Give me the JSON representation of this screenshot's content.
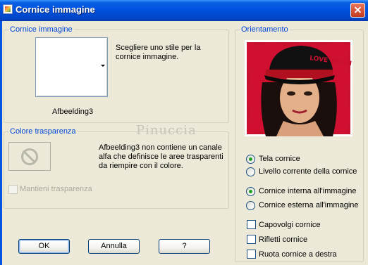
{
  "window": {
    "title": "Cornice immagine"
  },
  "frame_group": {
    "label": "Cornice immagine",
    "hint": "Scegliere uno stile per la cornice immagine.",
    "hint_line1": "Scegliere uno stile per la",
    "hint_line2": "cornice immagine.",
    "image_name": "Afbeelding3"
  },
  "transparency_group": {
    "label": "Colore trasparenza",
    "message_line1": "Afbeelding3 non contiene un canale",
    "message_line2": "alfa che definisce le aree trasparenti",
    "message_line3": "da riempire con il colore.",
    "keep_transparency_label": "Mantieni trasparenza"
  },
  "orientation_group": {
    "label": "Orientamento",
    "photo_text": "LOVE TRAIN",
    "radios_a": [
      {
        "label": "Tela cornice",
        "checked": true
      },
      {
        "label": "Livello corrente della cornice",
        "checked": false
      }
    ],
    "radios_b": [
      {
        "label": "Cornice interna all'immagine",
        "checked": true
      },
      {
        "label": "Cornice esterna all'immagine",
        "checked": false
      }
    ],
    "checkboxes": [
      {
        "label": "Capovolgi cornice",
        "checked": false
      },
      {
        "label": "Rifletti cornice",
        "checked": false
      },
      {
        "label": "Ruota cornice a destra",
        "checked": false
      }
    ]
  },
  "watermark": "Pinuccia",
  "buttons": {
    "ok": "OK",
    "cancel": "Annulla",
    "help": "?"
  }
}
